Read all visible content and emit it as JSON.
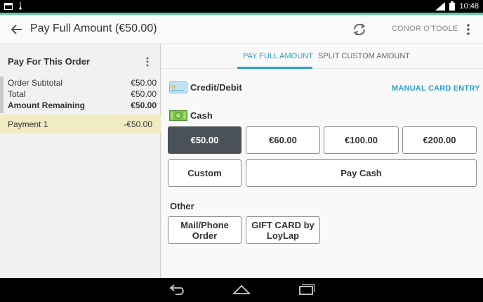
{
  "status_bar": {
    "time": "10:48"
  },
  "app_bar": {
    "title": "Pay Full Amount (€50.00)",
    "user": "CONOR O'TOOLE"
  },
  "order_panel": {
    "header": "Pay For This Order",
    "summary": [
      {
        "label": "Order Subtotal",
        "value": "€50.00"
      },
      {
        "label": "Total",
        "value": "€50.00"
      },
      {
        "label": "Amount Remaining",
        "value": "€50.00"
      }
    ],
    "payments": [
      {
        "label": "Payment 1",
        "value": "-€50.00"
      }
    ]
  },
  "tabs": [
    {
      "label": "PAY FULL AMOUNT",
      "active": true
    },
    {
      "label": "SPLIT CUSTOM AMOUNT",
      "active": false
    }
  ],
  "credit": {
    "label": "Credit/Debit",
    "manual_entry": "MANUAL CARD ENTRY"
  },
  "cash": {
    "label": "Cash",
    "amounts": [
      "€50.00",
      "€60.00",
      "€100.00",
      "€200.00"
    ],
    "selected_amount": "€50.00",
    "custom_label": "Custom",
    "pay_cash_label": "Pay Cash"
  },
  "other": {
    "label": "Other",
    "options": [
      "Mail/Phone\nOrder",
      "GIFT CARD by\nLoyLap"
    ]
  },
  "colors": {
    "accent": "#2aa1cd",
    "selected_button": "#4a5257",
    "payment_highlight": "#f1ebc3",
    "status_accent": "#5ac9a3"
  }
}
